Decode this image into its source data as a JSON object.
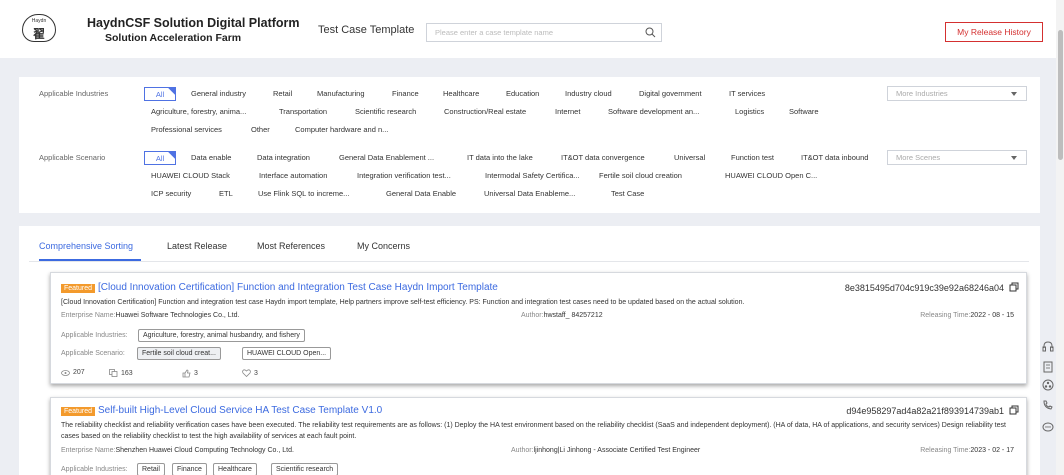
{
  "header": {
    "logo_top": "Haydn",
    "logo_char": "翟",
    "title_line1": "HaydnCSF Solution Digital Platform",
    "title_line2": "Solution Acceleration Farm",
    "section_title": "Test Case Template",
    "search_placeholder": "Please enter a case template name",
    "release_button": "My Release History"
  },
  "filters": {
    "industries": {
      "label": "Applicable Industries",
      "all": "All",
      "row1": [
        "General industry",
        "Retail",
        "Manufacturing",
        "Finance",
        "Healthcare",
        "Education",
        "Industry cloud",
        "Digital government",
        "IT services"
      ],
      "row2": [
        "Agriculture, forestry, anima...",
        "Transportation",
        "Scientific research",
        "Construction/Real estate",
        "Internet",
        "Software development an...",
        "Logistics",
        "Software"
      ],
      "row3": [
        "Professional services",
        "Other",
        "Computer hardware and n..."
      ],
      "more": "More Industries"
    },
    "scenarios": {
      "label": "Applicable Scenario",
      "all": "All",
      "row1": [
        "Data enable",
        "Data integration",
        "General Data Enablement ...",
        "IT data into the lake",
        "IT&OT data convergence",
        "Universal",
        "Function test",
        "IT&OT data inbound"
      ],
      "row2": [
        "HUAWEI CLOUD Stack",
        "Interface automation",
        "Integration verification test...",
        "Intermodal Safety Certifica...",
        "Fertile soil cloud creation",
        "HUAWEI CLOUD Open C..."
      ],
      "row3": [
        "ICP security",
        "ETL",
        "Use Flink SQL to increme...",
        "General Data Enable",
        "Universal Data Enableme...",
        "Test Case"
      ],
      "more": "More Scenes"
    }
  },
  "tabs": [
    "Comprehensive Sorting",
    "Latest Release",
    "Most References",
    "My Concerns"
  ],
  "cards": [
    {
      "badge": "Featured",
      "title": "[Cloud Innovation Certification] Function and Integration Test Case Haydn Import Template",
      "id": "8e3815495d704c919c39e92a68246a04",
      "description": "[Cloud Innovation Certification] Function and integration test case Haydn import template, Help partners improve self-test efficiency. PS: Function and integration test cases need to be updated based on the actual solution.",
      "enterprise_label": "Enterprise Name:",
      "enterprise": "Huawei Software Technologies Co., Ltd.",
      "author_label": "Author:",
      "author": "hwstaff_ 84257212",
      "release_label": "Releasing Time:",
      "release": "2022 - 08 - 15",
      "industries_label": "Applicable Industries:",
      "industries": [
        "Agriculture, forestry, animal husbandry, and fishery"
      ],
      "scenario_label": "Applicable Scenario:",
      "scenarios": [
        "Fertile soil cloud creat...",
        "HUAWEI CLOUD Open..."
      ],
      "views": "207",
      "references": "163",
      "likes": "3",
      "favorites": "3"
    },
    {
      "badge": "Featured",
      "title": "Self-built High-Level Cloud Service HA Test Case Template V1.0",
      "id": "d94e958297ad4a82a21f893914739ab1",
      "description": "The reliability checklist and reliability verification cases have been executed. The reliability test requirements are as follows: (1) Deploy the HA test environment based on the reliability checklist (SaaS and independent deployment). (HA of data, HA of applications, and security services) Design reliability test cases based on the reliability checklist to test the high availability of services at each fault point.",
      "enterprise_label": "Enterprise Name:",
      "enterprise": "Shenzhen Huawei Cloud Computing Technology Co., Ltd.",
      "author_label": "Author:",
      "author": "ljinhong|Li Jinhong - Associate Certified Test Engineer",
      "release_label": "Releasing Time:",
      "release": "2023 - 02 - 17",
      "industries_label": "Applicable Industries:",
      "industries": [
        "Retail",
        "Finance",
        "Healthcare",
        "Scientific research"
      ]
    }
  ]
}
